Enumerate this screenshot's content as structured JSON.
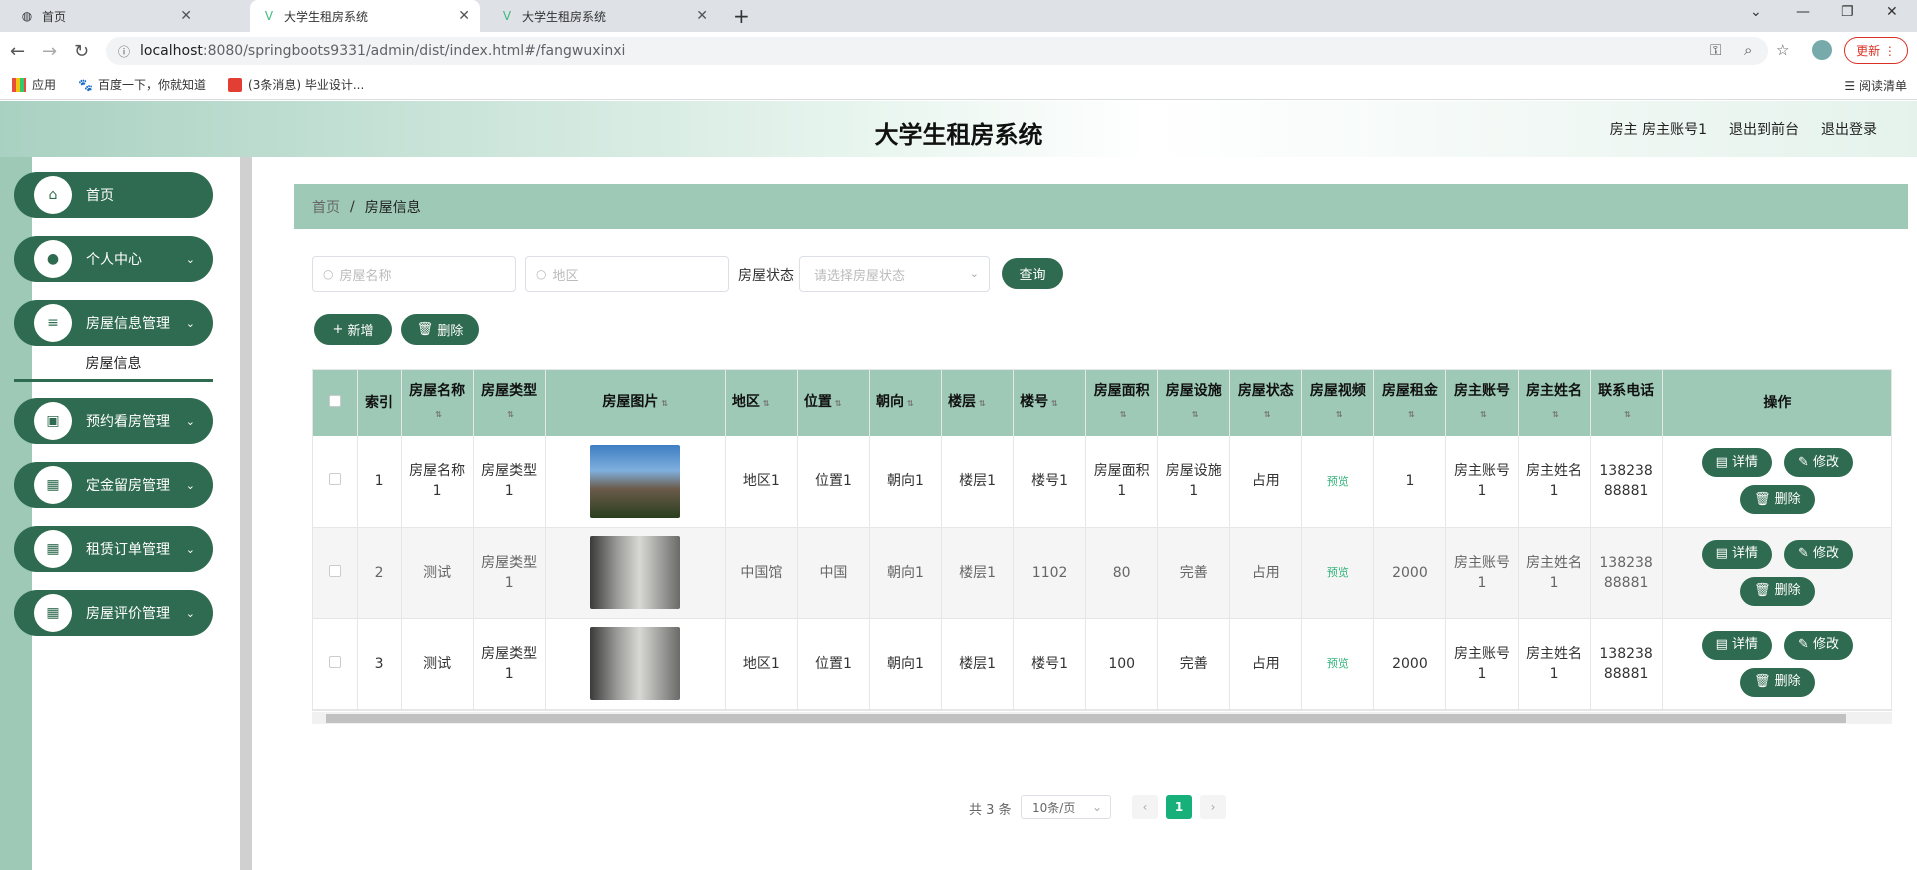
{
  "browser": {
    "tabs": [
      {
        "label": "首页",
        "icon": "globe-icon"
      },
      {
        "label": "大学生租房系统",
        "icon": "vue-icon"
      },
      {
        "label": "大学生租房系统",
        "icon": "vue-icon"
      }
    ],
    "url_host": "localhost",
    "url_path": ":8080/springboots9331/admin/dist/index.html#/fangwuxinxi",
    "update_label": "更新",
    "bookmarks": [
      "应用",
      "百度一下，你就知道",
      "(3条消息) 毕业设计..."
    ],
    "reading_list": "阅读清单"
  },
  "header": {
    "title": "大学生租房系统",
    "user": "房主 房主账号1",
    "to_front": "退出到前台",
    "logout": "退出登录"
  },
  "sidebar": {
    "items": [
      {
        "label": "首页",
        "icon": "home-icon"
      },
      {
        "label": "个人中心",
        "icon": "user-icon"
      },
      {
        "label": "房屋信息管理",
        "icon": "menu-icon"
      },
      {
        "label": "预约看房管理",
        "icon": "briefcase-icon"
      },
      {
        "label": "定金留房管理",
        "icon": "grid-icon"
      },
      {
        "label": "租赁订单管理",
        "icon": "grid-icon"
      },
      {
        "label": "房屋评价管理",
        "icon": "grid-icon"
      }
    ],
    "active_sub": "房屋信息"
  },
  "breadcrumb": {
    "home": "首页",
    "current": "房屋信息"
  },
  "search": {
    "name_placeholder": "房屋名称",
    "area_placeholder": "地区",
    "status_label": "房屋状态",
    "status_placeholder": "请选择房屋状态",
    "query_label": "查询"
  },
  "toolbar": {
    "add_label": "新增",
    "delete_label": "删除"
  },
  "table": {
    "headers": [
      "索引",
      "房屋名称",
      "房屋类型",
      "房屋图片",
      "地区",
      "位置",
      "朝向",
      "楼层",
      "楼号",
      "房屋面积",
      "房屋设施",
      "房屋状态",
      "房屋视频",
      "房屋租金",
      "房主账号",
      "房主姓名",
      "联系电话",
      "操作"
    ],
    "rows": [
      {
        "index": "1",
        "name": "房屋名称1",
        "type": "房屋类型1",
        "area": "地区1",
        "location": "位置1",
        "orientation": "朝向1",
        "floor": "楼层1",
        "building": "楼号1",
        "size": "房屋面积1",
        "facility": "房屋设施1",
        "status": "占用",
        "video": "预览",
        "rent": "1",
        "owner_account": "房主账号1",
        "owner_name": "房主姓名1",
        "phone": "13823888881"
      },
      {
        "index": "2",
        "name": "测试",
        "type": "房屋类型1",
        "area": "中国馆",
        "location": "中国",
        "orientation": "朝向1",
        "floor": "楼层1",
        "building": "1102",
        "size": "80",
        "facility": "完善",
        "status": "占用",
        "video": "预览",
        "rent": "2000",
        "owner_account": "房主账号1",
        "owner_name": "房主姓名1",
        "phone": "13823888881"
      },
      {
        "index": "3",
        "name": "测试",
        "type": "房屋类型1",
        "area": "地区1",
        "location": "位置1",
        "orientation": "朝向1",
        "floor": "楼层1",
        "building": "楼号1",
        "size": "100",
        "facility": "完善",
        "status": "占用",
        "video": "预览",
        "rent": "2000",
        "owner_account": "房主账号1",
        "owner_name": "房主姓名1",
        "phone": "13823888881"
      }
    ],
    "actions": {
      "detail": "详情",
      "edit": "修改",
      "delete": "删除"
    }
  },
  "pagination": {
    "total": "共 3 条",
    "page_size": "10条/页",
    "current_page": "1"
  },
  "colors": {
    "primary": "#2f6b50",
    "header_bg": "#9dc9b6",
    "active_page": "#17b07b",
    "preview": "#33b47a"
  }
}
